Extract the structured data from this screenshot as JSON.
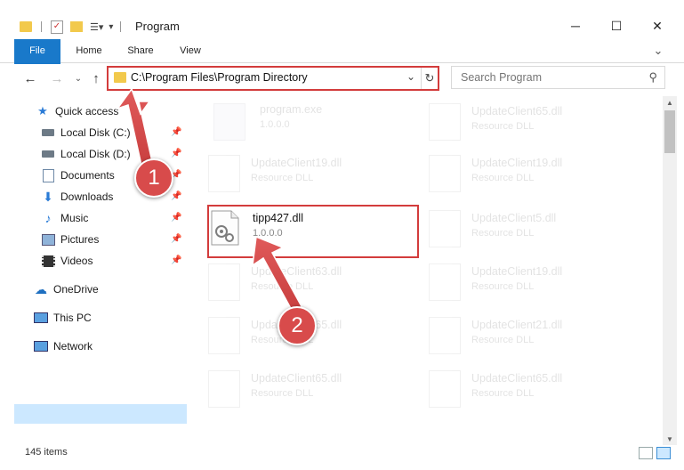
{
  "window": {
    "title": "Program",
    "minimize_icon": "─",
    "maximize_icon": "☐",
    "close_icon": "✕"
  },
  "ribbon": {
    "tabs": [
      {
        "label": "File"
      },
      {
        "label": "Home"
      },
      {
        "label": "Share"
      },
      {
        "label": "View"
      }
    ],
    "expand_icon": "⌄"
  },
  "address": {
    "path": "C:\\Program Files\\Program Directory",
    "search_placeholder": "Search Program"
  },
  "nav": {
    "items": [
      {
        "label": "Quick access",
        "icon": "star-icon"
      },
      {
        "label": "Local Disk (C:)",
        "icon": "drive-icon",
        "pinned": true
      },
      {
        "label": "Local Disk (D:)",
        "icon": "drive-icon",
        "pinned": true
      },
      {
        "label": "Documents",
        "icon": "documents-icon",
        "pinned": true
      },
      {
        "label": "Downloads",
        "icon": "download-icon",
        "pinned": true
      },
      {
        "label": "Music",
        "icon": "music-icon",
        "pinned": true
      },
      {
        "label": "Pictures",
        "icon": "pictures-icon",
        "pinned": true
      },
      {
        "label": "Videos",
        "icon": "videos-icon",
        "pinned": true
      },
      {
        "label": "OneDrive",
        "icon": "cloud-icon"
      },
      {
        "label": "This PC",
        "icon": "computer-icon",
        "selected": true
      },
      {
        "label": "Network",
        "icon": "network-icon"
      }
    ]
  },
  "files": [
    {
      "name": "program.exe",
      "desc": "1.0.0.0"
    },
    {
      "name": "UpdateClient65.dll",
      "desc": "Resource DLL"
    },
    {
      "name": "UpdateClient19.dll",
      "desc": "Resource DLL"
    },
    {
      "name": "UpdateClient19.dll",
      "desc": "Resource DLL"
    },
    {
      "name": "tipp427.dll",
      "desc": "1.0.0.0",
      "highlighted": true
    },
    {
      "name": "UpdateClient5.dll",
      "desc": "Resource DLL"
    },
    {
      "name": "UpdateClient63.dll",
      "desc": "Resource DLL"
    },
    {
      "name": "UpdateClient19.dll",
      "desc": "Resource DLL"
    },
    {
      "name": "UpdateClient65.dll",
      "desc": "Resource DLL"
    },
    {
      "name": "UpdateClient21.dll",
      "desc": "Resource DLL"
    },
    {
      "name": "UpdateClient65.dll",
      "desc": "Resource DLL"
    },
    {
      "name": "UpdateClient65.dll",
      "desc": "Resource DLL"
    }
  ],
  "status": {
    "item_count": "145 items"
  },
  "callouts": [
    {
      "label": "1"
    },
    {
      "label": "2"
    }
  ],
  "colors": {
    "accent": "#1979ca",
    "highlight_box": "#d33c3c",
    "callout": "#d84b4b",
    "selected_bg": "#cce8ff"
  }
}
